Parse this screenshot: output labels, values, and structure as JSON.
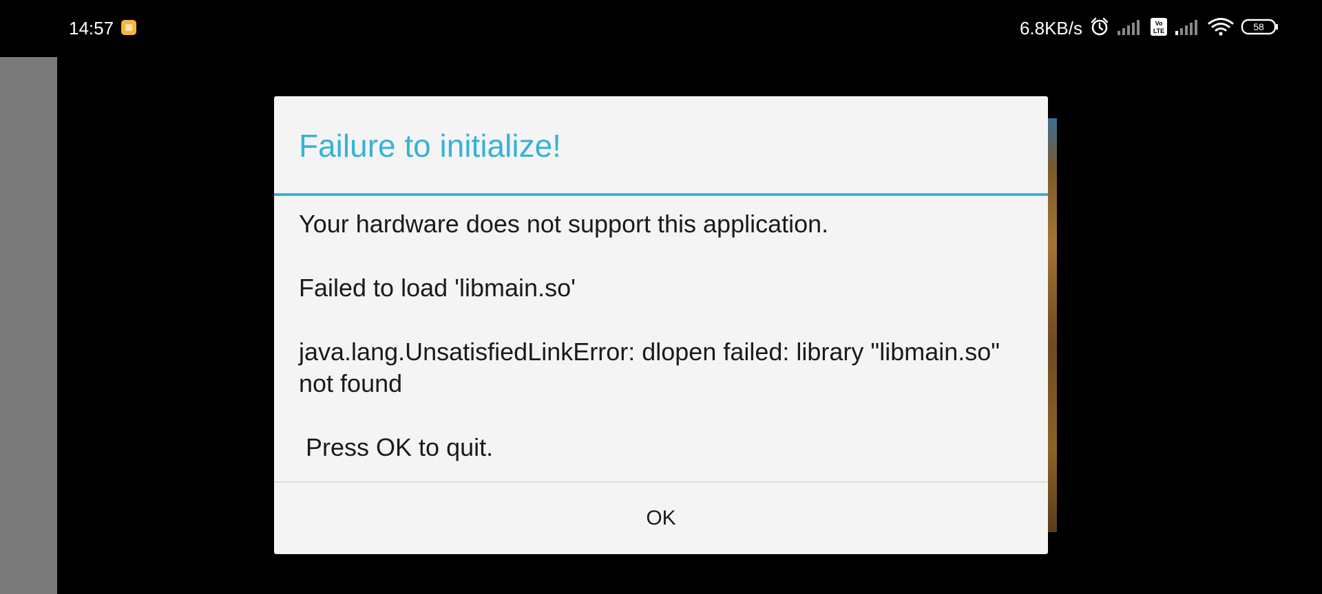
{
  "status_bar": {
    "time": "14:57",
    "network_speed": "6.8KB/s",
    "volte_label": "Vo LTE",
    "battery_level": "58",
    "icons": [
      "notification-icon",
      "alarm-icon",
      "signal-icon",
      "volte-icon",
      "signal-icon",
      "wifi-icon",
      "battery-icon"
    ]
  },
  "dialog": {
    "title": "Failure to initialize!",
    "message_lines": [
      "Your hardware does not support this application.",
      "Failed to load 'libmain.so'",
      "java.lang.UnsatisfiedLinkError: dlopen failed: library \"libmain.so\" not found",
      " Press OK to quit."
    ],
    "ok_label": "OK"
  },
  "colors": {
    "accent": "#36b2d8",
    "dialog_background": "#f4f4f4",
    "screen_background": "#000000",
    "side_panel": "#7a7a7a"
  }
}
